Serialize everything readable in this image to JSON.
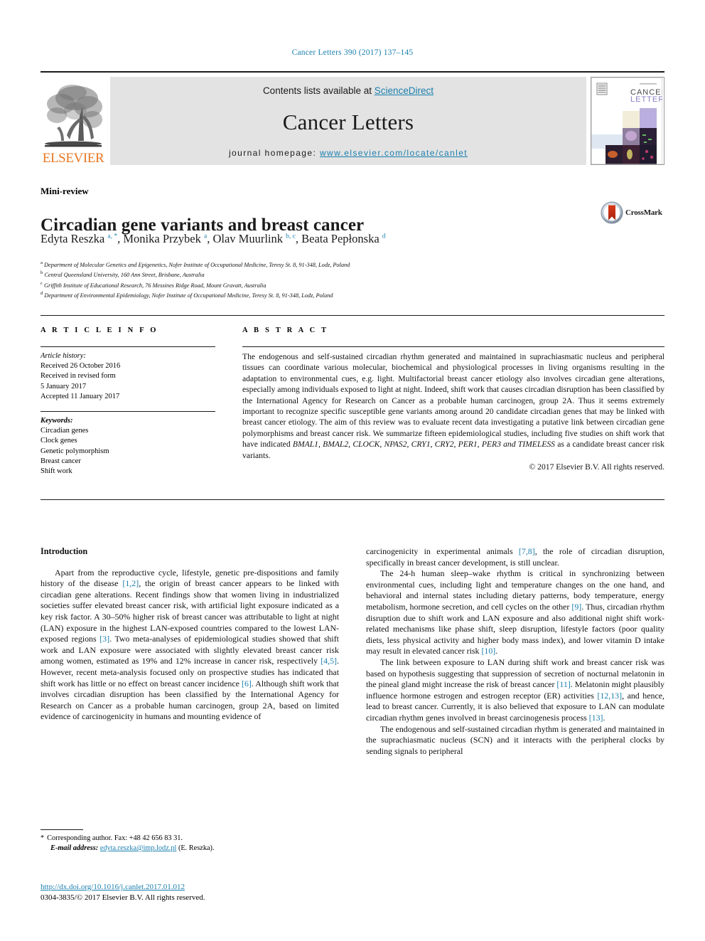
{
  "running_head": "Cancer Letters 390 (2017) 137–145",
  "masthead": {
    "contents_prefix": "Contents lists available at ",
    "sciencedirect": "ScienceDirect",
    "journal_title": "Cancer Letters",
    "homepage_label": "journal homepage: ",
    "homepage_url": "www.elsevier.com/locate/canlet",
    "publisher": "ELSEVIER",
    "cover_title_line1": "CANCER",
    "cover_title_line2": "LETTERS",
    "link_color": "#1a7fae",
    "band_color": "#e3e3e3",
    "elsevier_orange": "#E87722"
  },
  "article": {
    "doctype": "Mini-review",
    "title": "Circadian gene variants and breast cancer",
    "crossmark_label": "CrossMark",
    "authors_html": "Edyta Reszka <sup>a, *</sup>, Monika Przybek <sup>a</sup>, Olav Muurlink <sup>b, c</sup>, Beata Pepłonska <sup>d</sup>",
    "affiliations": [
      {
        "marker": "a",
        "text": "Department of Molecular Genetics and Epigenetics, Nofer Institute of Occupational Medicine, Teresy St. 8, 91-348, Lodz, Poland"
      },
      {
        "marker": "b",
        "text": "Central Queensland University, 160 Ann Street, Brisbane, Australia"
      },
      {
        "marker": "c",
        "text": "Griffith Institute of Educational Research, 76 Messines Ridge Road, Mount Gravatt, Australia"
      },
      {
        "marker": "d",
        "text": "Department of Environmental Epidemiology, Nofer Institute of Occupational Medicine, Teresy St. 8, 91-348, Lodz, Poland"
      }
    ]
  },
  "info": {
    "heading": "A R T I C L E   I N F O",
    "history_label": "Article history:",
    "history": [
      "Received 26 October 2016",
      "Received in revised form",
      "5 January 2017",
      "Accepted 11 January 2017"
    ],
    "keywords_label": "Keywords:",
    "keywords": [
      "Circadian genes",
      "Clock genes",
      "Genetic polymorphism",
      "Breast cancer",
      "Shift work"
    ]
  },
  "abstract": {
    "heading": "A B S T R A C T",
    "text_before_genes": "The endogenous and self-sustained circadian rhythm generated and maintained in suprachiasmatic nucleus and peripheral tissues can coordinate various molecular, biochemical and physiological processes in living organisms resulting in the adaptation to environmental cues, e.g. light. Multifactorial breast cancer etiology also involves circadian gene alterations, especially among individuals exposed to light at night. Indeed, shift work that causes circadian disruption has been classified by the International Agency for Research on Cancer as a probable human carcinogen, group 2A. Thus it seems extremely important to recognize specific susceptible gene variants among around 20 candidate circadian genes that may be linked with breast cancer etiology. The aim of this review was to evaluate recent data investigating a putative link between circadian gene polymorphisms and breast cancer risk. We summarize fifteen epidemiological studies, including five studies on shift work that have indicated ",
    "gene_list": "BMAL1, BMAL2, CLOCK, NPAS2, CRY1, CRY2, PER1, PER3 and TIMELESS",
    "text_after_genes": " as a candidate breast cancer risk variants.",
    "copyright": "© 2017 Elsevier B.V. All rights reserved."
  },
  "body": {
    "section_heading": "Introduction",
    "left_paragraphs": [
      {
        "indent": true,
        "parts": [
          {
            "t": "Apart from the reproductive cycle, lifestyle, genetic pre-dispositions and family history of the disease "
          },
          {
            "t": "[1,2]",
            "ref": true
          },
          {
            "t": ", the origin of breast cancer appears to be linked with circadian gene alterations. Recent findings show that women living in industrialized societies suffer elevated breast cancer risk, with artificial light exposure indicated as a key risk factor. A 30–50% higher risk of breast cancer was attributable to light at night (LAN) exposure in the highest LAN-exposed countries compared to the lowest LAN-exposed regions "
          },
          {
            "t": "[3]",
            "ref": true
          },
          {
            "t": ". Two meta-analyses of epidemiological studies showed that shift work and LAN exposure were associated with slightly elevated breast cancer risk among women, estimated as 19% and 12% increase in cancer risk, respectively "
          },
          {
            "t": "[4,5]",
            "ref": true
          },
          {
            "t": ". However, recent meta-analysis focused only on prospective studies has indicated that shift work has little or no effect on breast cancer incidence "
          },
          {
            "t": "[6]",
            "ref": true
          },
          {
            "t": ". Although shift work that involves circadian disruption has been classified by the International Agency for Research on Cancer as a probable human carcinogen, group 2A, based on limited evidence of carcinogenicity in humans and mounting evidence of"
          }
        ]
      }
    ],
    "right_paragraphs": [
      {
        "indent": false,
        "parts": [
          {
            "t": "carcinogenicity in experimental animals "
          },
          {
            "t": "[7,8]",
            "ref": true
          },
          {
            "t": ", the role of circadian disruption, specifically in breast cancer development, is still unclear."
          }
        ]
      },
      {
        "indent": true,
        "parts": [
          {
            "t": "The 24-h human sleep–wake rhythm is critical in synchronizing between environmental cues, including light and temperature changes on the one hand, and behavioral and internal states including dietary patterns, body temperature, energy metabolism, hormone secretion, and cell cycles on the other "
          },
          {
            "t": "[9]",
            "ref": true
          },
          {
            "t": ". Thus, circadian rhythm disruption due to shift work and LAN exposure and also additional night shift work-related mechanisms like phase shift, sleep disruption, lifestyle factors (poor quality diets, less physical activity and higher body mass index), and lower vitamin D intake may result in elevated cancer risk "
          },
          {
            "t": "[10]",
            "ref": true
          },
          {
            "t": "."
          }
        ]
      },
      {
        "indent": true,
        "parts": [
          {
            "t": "The link between exposure to LAN during shift work and breast cancer risk was based on hypothesis suggesting that suppression of secretion of nocturnal melatonin in the pineal gland might increase the risk of breast cancer "
          },
          {
            "t": "[11]",
            "ref": true
          },
          {
            "t": ". Melatonin might plausibly influence hormone estrogen and estrogen receptor (ER) activities "
          },
          {
            "t": "[12,13]",
            "ref": true
          },
          {
            "t": ", and hence, lead to breast cancer. Currently, it is also believed that exposure to LAN can modulate circadian rhythm genes involved in breast carcinogenesis process "
          },
          {
            "t": "[13]",
            "ref": true
          },
          {
            "t": "."
          }
        ]
      },
      {
        "indent": true,
        "parts": [
          {
            "t": "The endogenous and self-sustained circadian rhythm is generated and maintained in the suprachiasmatic nucleus (SCN) and it interacts with the peripheral clocks by sending signals to peripheral"
          }
        ]
      }
    ]
  },
  "footnote": {
    "star": "*",
    "corresponding": "Corresponding author. Fax: +48 42 656 83 31.",
    "email_label": "E-mail address:",
    "email": "edyta.reszka@imp.lodz.pl",
    "email_owner": "(E. Reszka)."
  },
  "footer": {
    "doi": "http://dx.doi.org/10.1016/j.canlet.2017.01.012",
    "issn_line": "0304-3835/© 2017 Elsevier B.V. All rights reserved."
  }
}
